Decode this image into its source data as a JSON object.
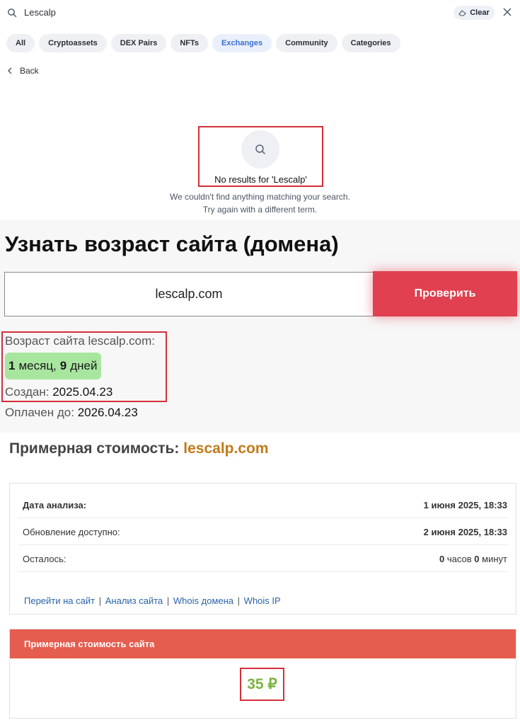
{
  "search": {
    "query": "Lescalp",
    "clear_label": "Clear"
  },
  "tabs": [
    "All",
    "Cryptoassets",
    "DEX Pairs",
    "NFTs",
    "Exchanges",
    "Community",
    "Categories"
  ],
  "active_tab": "Exchanges",
  "nav": {
    "back_label": "Back"
  },
  "no_results": {
    "title": "No results for 'Lescalp'",
    "line1": "We couldn't find anything matching your search.",
    "line2": "Try again with a different term."
  },
  "age_check": {
    "heading": "Узнать возраст сайта (домена)",
    "domain_value": "lescalp.com",
    "check_button": "Проверить",
    "age_label": "Возраст сайта lescalp.com:",
    "age_num1": "1",
    "age_unit1": "месяц,",
    "age_num2": "9",
    "age_unit2": "дней",
    "created_label": "Создан:",
    "created_value": "2025.04.23",
    "paid_label": "Оплачен до:",
    "paid_value": "2026.04.23"
  },
  "valuation": {
    "heading_prefix": "Примерная стоимость:",
    "heading_domain": "lescalp.com",
    "rows": [
      {
        "key": "Дата анализа:",
        "value": "1 июня 2025, 18:33"
      },
      {
        "key": "Обновление доступно:",
        "value": "2 июня 2025, 18:33"
      }
    ],
    "remaining": {
      "key": "Осталось:",
      "hours": "0",
      "hours_unit": "часов",
      "minutes": "0",
      "minutes_unit": "минут"
    },
    "links": [
      "Перейти на сайт",
      "Анализ сайта",
      "Whois домена",
      "Whois IP"
    ],
    "link_separator": "|",
    "estimate_header": "Примерная стоимость сайта",
    "estimate_value": "35 ₽"
  },
  "colors": {
    "accent_red": "#e0404f",
    "highlight_box": "#d32f3a",
    "age_badge": "#a8e6a0",
    "domain_orange": "#c07a19",
    "estimate_header": "#e55d4f",
    "estimate_green": "#7cb342",
    "active_tab_text": "#3b6fd4"
  }
}
